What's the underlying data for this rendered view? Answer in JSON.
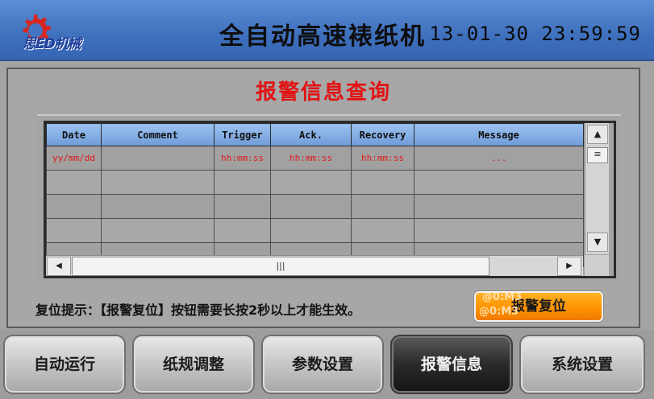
{
  "header": {
    "logo_text": "思ED机械",
    "app_title": "全自动高速裱纸机",
    "datetime": "13-01-30 23:59:59"
  },
  "page": {
    "title": "报警信息查询"
  },
  "alarm_table": {
    "columns": [
      "Date",
      "Comment",
      "Trigger",
      "Ack.",
      "Recovery",
      "Message"
    ],
    "rows": [
      [
        "yy/mm/dd",
        "",
        "hh:mm:ss",
        "hh:mm:ss",
        "hh:mm:ss",
        "..."
      ],
      [
        "",
        "",
        "",
        "",
        "",
        ""
      ],
      [
        "",
        "",
        "",
        "",
        "",
        ""
      ],
      [
        "",
        "",
        "",
        "",
        "",
        ""
      ],
      [
        "",
        "",
        "",
        "",
        "",
        ""
      ]
    ],
    "scroll_up_icon": "▲",
    "scroll_down_icon": "▼",
    "scroll_left_icon": "◀",
    "scroll_right_icon": "▶",
    "v_thumb_grip": "≡",
    "h_thumb_grip": "|||"
  },
  "reset": {
    "hint": "复位提示：【报警复位】按钮需要长按2秒以上才能生效。",
    "button_label": "报警复位",
    "ghost_label_1": "@0:M3",
    "ghost_label_2": "@0:M3"
  },
  "nav": {
    "items": [
      {
        "label": "自动运行"
      },
      {
        "label": "纸规调整"
      },
      {
        "label": "参数设置"
      },
      {
        "label": "报警信息",
        "active": true
      },
      {
        "label": "系统设置"
      }
    ]
  },
  "colors": {
    "header_blue": "#4375c2",
    "title_red": "#e21212",
    "accent_orange": "#ff9300",
    "table_header": "#86aee3"
  }
}
